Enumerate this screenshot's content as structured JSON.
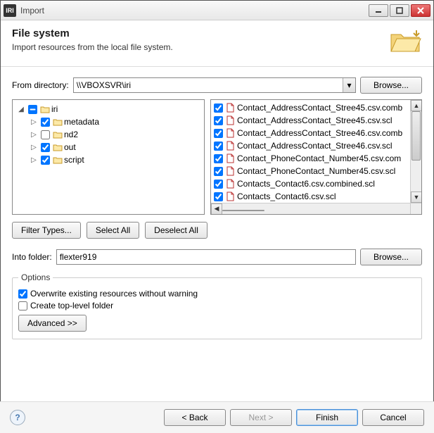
{
  "window": {
    "title": "Import",
    "app_badge": "IRI"
  },
  "header": {
    "title": "File system",
    "subtitle": "Import resources from the local file system."
  },
  "from_dir": {
    "label": "From directory:",
    "value": "\\\\VBOXSVR\\iri",
    "browse": "Browse..."
  },
  "tree": {
    "root": {
      "label": "iri",
      "checked": true,
      "indeterminate": true,
      "expanded": true
    },
    "children": [
      {
        "label": "metadata",
        "checked": true,
        "expanded": false
      },
      {
        "label": "nd2",
        "checked": false,
        "expanded": false
      },
      {
        "label": "out",
        "checked": true,
        "expanded": false
      },
      {
        "label": "script",
        "checked": true,
        "expanded": false
      }
    ]
  },
  "files": [
    {
      "label": "Contact_AddressContact_Stree45.csv.comb",
      "checked": true
    },
    {
      "label": "Contact_AddressContact_Stree45.csv.scl",
      "checked": true
    },
    {
      "label": "Contact_AddressContact_Stree46.csv.comb",
      "checked": true
    },
    {
      "label": "Contact_AddressContact_Stree46.csv.scl",
      "checked": true
    },
    {
      "label": "Contact_PhoneContact_Number45.csv.com",
      "checked": true
    },
    {
      "label": "Contact_PhoneContact_Number45.csv.scl",
      "checked": true
    },
    {
      "label": "Contacts_Contact6.csv.combined.scl",
      "checked": true
    },
    {
      "label": "Contacts_Contact6.csv.scl",
      "checked": true
    }
  ],
  "buttons": {
    "filter_types": "Filter Types...",
    "select_all": "Select All",
    "deselect_all": "Deselect All",
    "advanced": "Advanced >>"
  },
  "into_folder": {
    "label": "Into folder:",
    "value": "flexter919",
    "browse": "Browse..."
  },
  "options": {
    "legend": "Options",
    "overwrite": {
      "label": "Overwrite existing resources without warning",
      "checked": true
    },
    "toplevel": {
      "label": "Create top-level folder",
      "checked": false
    }
  },
  "wizard": {
    "back": "< Back",
    "next": "Next >",
    "finish": "Finish",
    "cancel": "Cancel"
  }
}
